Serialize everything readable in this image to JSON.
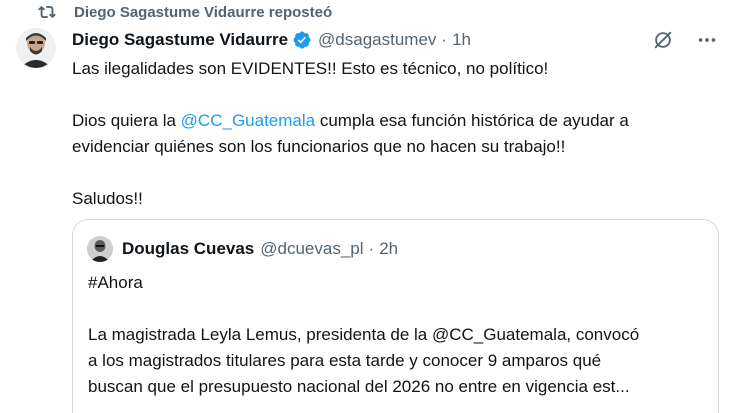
{
  "repost": {
    "label": "Diego Sagastume Vidaurre reposteó"
  },
  "author": {
    "name": "Diego Sagastume Vidaurre",
    "handle": "@dsagastumev",
    "separator": "·",
    "time": "1h",
    "verified_color": "#1d9bf0"
  },
  "post": {
    "line1": "Las ilegalidades son EVIDENTES!! Esto es técnico, no político!",
    "line2_before": "Dios quiera la ",
    "line2_mention": "@CC_Guatemala",
    "line2_after": " cumpla esa función histórica de ayudar a",
    "line3": "evidenciar quiénes son los funcionarios que no hacen su trabajo!!",
    "line4": "Saludos!!"
  },
  "quote": {
    "name": "Douglas Cuevas",
    "handle": "@dcuevas_pl",
    "separator": "·",
    "time": "2h",
    "line1": "#Ahora",
    "line2": "La magistrada Leyla Lemus, presidenta de la @CC_Guatemala, convocó",
    "line3": "a los magistrados titulares para esta tarde y conocer 9 amparos qué",
    "line4": "buscan que el presupuesto nacional del 2026 no entre en vigencia est..."
  },
  "icons": {
    "repost": "repost-icon",
    "verified": "verified-badge-icon",
    "grok": "grok-icon",
    "more": "more-icon"
  },
  "colors": {
    "mention": "#1d9bf0",
    "secondary_text": "#536471",
    "border": "#cfd9de"
  }
}
